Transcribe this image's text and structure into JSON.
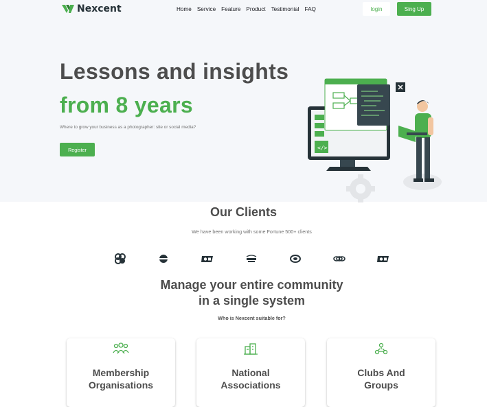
{
  "header": {
    "brand": "Nexcent",
    "nav": [
      "Home",
      "Service",
      "Feature",
      "Product",
      "Testimonial",
      "FAQ"
    ],
    "login_label": "login",
    "signup_label": "Sing Up"
  },
  "hero": {
    "title_line1": "Lessons and insights",
    "title_line2": "from 8 years",
    "subtitle": "Where to grow your business as a photographer: site or social media?",
    "register_label": "Register"
  },
  "clients": {
    "title": "Our Clients",
    "subtitle": "We have been working with some Fortune 500+ clients",
    "logos": [
      "client-logo-1",
      "client-logo-2",
      "client-logo-3",
      "client-logo-4",
      "client-logo-5",
      "client-logo-6",
      "client-logo-7"
    ]
  },
  "community": {
    "title_line1": "Manage your entire community",
    "title_line2": "in a single system",
    "subtitle": "Who is Nexcent suitable for?",
    "cards": [
      {
        "line1": "Membership",
        "line2": "Organisations",
        "icon": "people-group-icon"
      },
      {
        "line1": "National",
        "line2": "Associations",
        "icon": "buildings-icon"
      },
      {
        "line1": "Clubs And",
        "line2": "Groups",
        "icon": "network-icon"
      }
    ]
  },
  "colors": {
    "primary": "#4caf4f",
    "text": "#4d4d4d",
    "hero_bg": "#f5f7fa",
    "dark": "#263238"
  }
}
